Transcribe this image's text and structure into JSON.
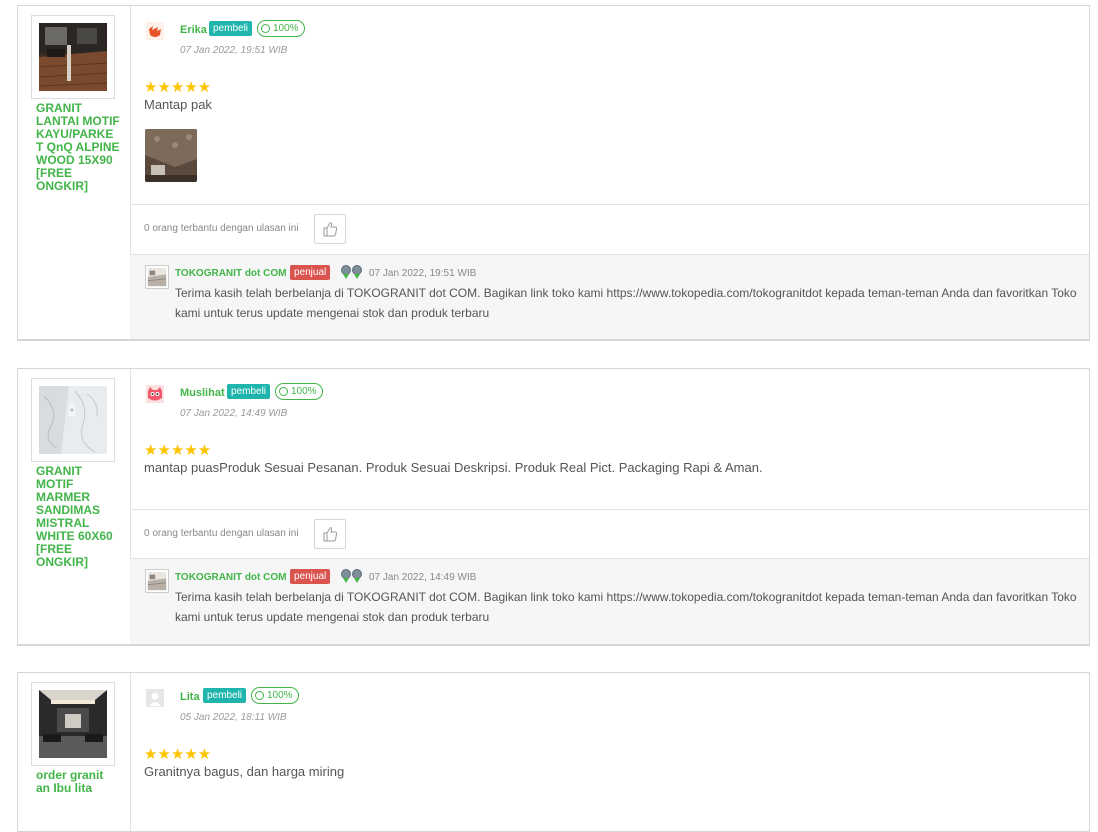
{
  "reviews": [
    {
      "product_name": "GRANIT LANTAI MOTIF KAYU/PARKET QnQ ALPINE WOOD 15X90 [FREE ONGKIR]",
      "user": "Erika",
      "role_badge": "pembeli",
      "reputation": "100%",
      "date": "07 Jan 2022, 19:51 WIB",
      "stars": "★★★★★",
      "text": "Mantap pak",
      "has_photo": true,
      "helpful_text": "0 orang terbantu dengan ulasan ini",
      "seller": {
        "name": "TOKOGRANIT dot COM",
        "badge": "penjual",
        "date": "07 Jan 2022, 19:51 WIB",
        "reply": "Terima kasih telah berbelanja di TOKOGRANIT dot COM. Bagikan link toko kami https://www.tokopedia.com/tokogranitdot kepada teman-teman Anda dan favoritkan Toko kami untuk terus update mengenai stok dan produk terbaru"
      }
    },
    {
      "product_name": "GRANIT MOTIF MARMER SANDIMAS MISTRAL WHITE 60X60 [FREE ONGKIR]",
      "user": "Muslihat",
      "role_badge": "pembeli",
      "reputation": "100%",
      "date": "07 Jan 2022, 14:49 WIB",
      "stars": "★★★★★",
      "text": "mantap puasProduk Sesuai Pesanan. Produk Sesuai Deskripsi. Produk Real Pict. Packaging Rapi & Aman.",
      "has_photo": false,
      "helpful_text": "0 orang terbantu dengan ulasan ini",
      "seller": {
        "name": "TOKOGRANIT dot COM",
        "badge": "penjual",
        "date": "07 Jan 2022, 14:49 WIB",
        "reply": "Terima kasih telah berbelanja di TOKOGRANIT dot COM. Bagikan link toko kami https://www.tokopedia.com/tokogranitdot kepada teman-teman Anda dan favoritkan Toko kami untuk terus update mengenai stok dan produk terbaru"
      }
    },
    {
      "product_name": "order granit an Ibu lita",
      "user": "Lita",
      "role_badge": "pembeli",
      "reputation": "100%",
      "date": "05 Jan 2022, 18:11 WIB",
      "stars": "★★★★★",
      "text": "Granitnya bagus, dan harga miring"
    }
  ],
  "colors": {
    "green": "#42b549",
    "buyer_badge": "#1fb5ad",
    "seller_badge": "#d9534f",
    "star": "#ffc400"
  }
}
